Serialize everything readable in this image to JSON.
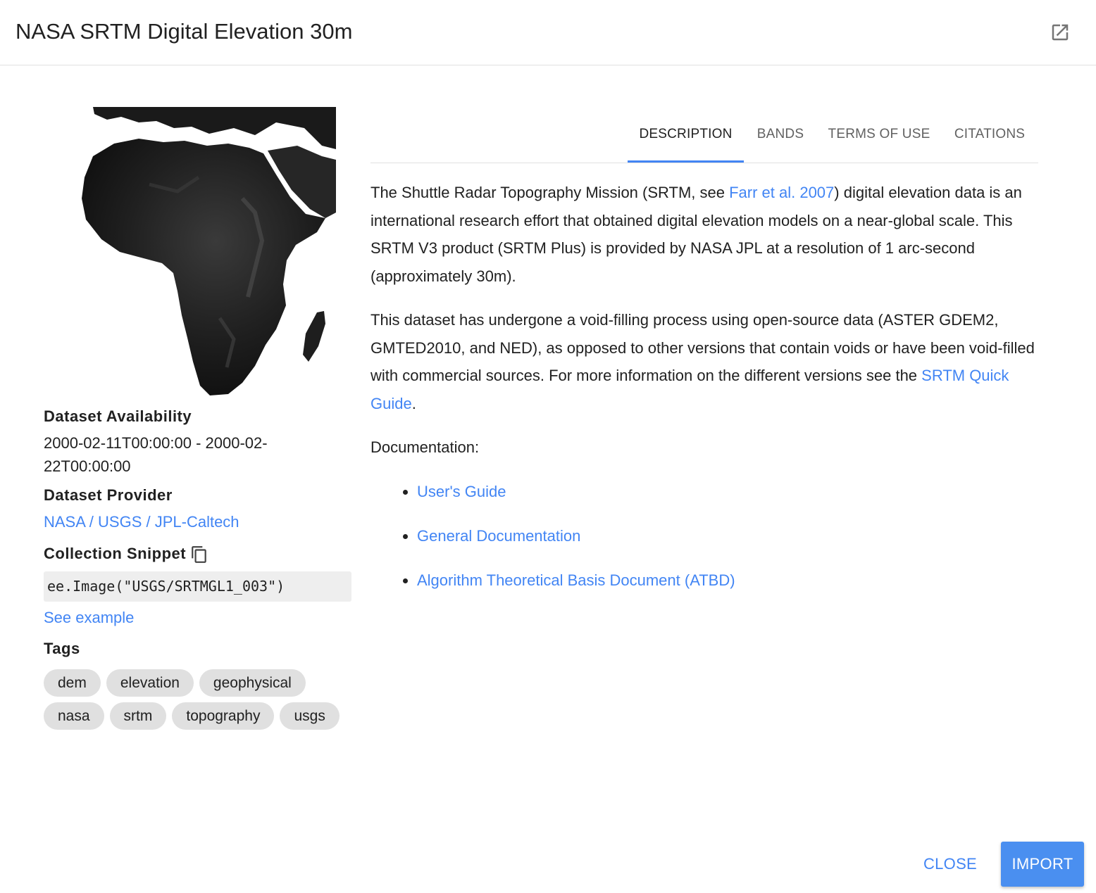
{
  "dialog": {
    "title": "NASA SRTM Digital Elevation 30m",
    "open_icon": "open-in-new-icon"
  },
  "sidebar": {
    "thumbnail": "africa-elevation-map",
    "availability_label": "Dataset Availability",
    "availability_value": "2000-02-11T00:00:00 - 2000-02-22T00:00:00",
    "provider_label": "Dataset Provider",
    "provider_value": "NASA / USGS / JPL-Caltech",
    "snippet_label": "Collection Snippet",
    "copy_icon": "copy-icon",
    "snippet_code": "ee.Image(\"USGS/SRTMGL1_003\")",
    "see_example": "See example",
    "tags_label": "Tags",
    "tags_row1": [
      "dem",
      "elevation",
      "geophysical"
    ],
    "tags_row2": [
      "nasa",
      "srtm",
      "topography",
      "usgs"
    ]
  },
  "tabs": {
    "description": "DESCRIPTION",
    "bands": "BANDS",
    "terms": "TERMS OF USE",
    "citations": "CITATIONS",
    "active": "DESCRIPTION"
  },
  "description": {
    "p1_before": "The Shuttle Radar Topography Mission (SRTM, see ",
    "p1_link": "Farr et al. 2007",
    "p1_after": ") digital elevation data is an international research effort that obtained digital elevation models on a near-global scale. This SRTM V3 product (SRTM Plus) is provided by NASA JPL at a resolution of 1 arc-second (approximately 30m).",
    "p2_before": "This dataset has undergone a void-filling process using open-source data (ASTER GDEM2, GMTED2010, and NED), as opposed to other versions that contain voids or have been void-filled with commercial sources. For more information on the different versions see the ",
    "p2_link": "SRTM Quick Guide",
    "p2_after": ".",
    "doc_label": "Documentation:",
    "doc_links": [
      "User's Guide",
      "General Documentation",
      "Algorithm Theoretical Basis Document (ATBD)"
    ]
  },
  "footer": {
    "close": "CLOSE",
    "import": "IMPORT"
  },
  "colors": {
    "accent": "#4285f4",
    "import_bg": "#4a8ff0",
    "tag_bg": "#e0e0e0",
    "snippet_bg": "#eeeeee"
  }
}
